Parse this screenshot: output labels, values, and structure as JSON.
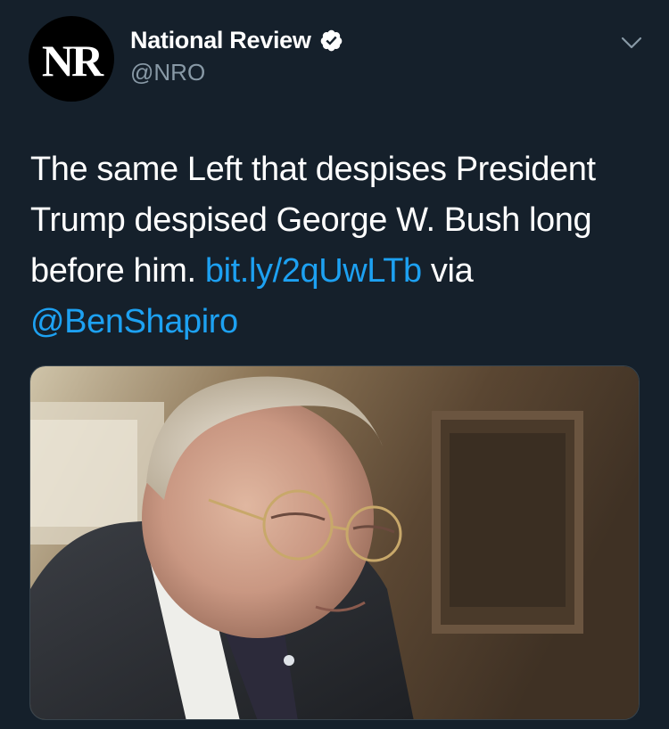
{
  "account": {
    "avatar_text": "NR",
    "display_name": "National Review",
    "handle": "@NRO",
    "verified": true
  },
  "tweet": {
    "text_part1": "The same Left that despises President Trump despised George W. Bush long before him. ",
    "link": "bit.ly/2qUwLTb",
    "text_part2": " via ",
    "mention": "@BenShapiro"
  },
  "media": {
    "description_icon": "photo"
  },
  "colors": {
    "background": "#15202b",
    "link": "#1da1f2",
    "secondary_text": "#8899a6",
    "verified_badge": "#ffffff"
  },
  "icons": {
    "verified": "verified-badge-icon",
    "menu": "chevron-down-icon"
  }
}
